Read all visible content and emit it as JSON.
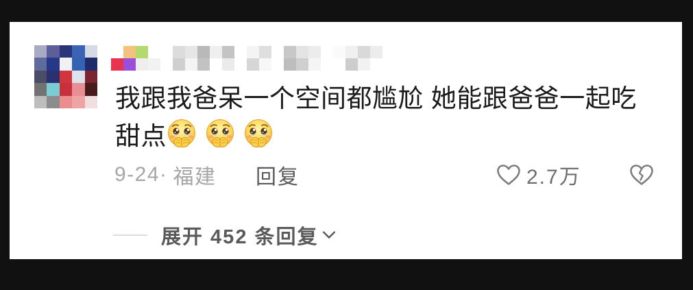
{
  "comment": {
    "text_lines": [
      "我跟我爸呆一个空间都尴尬 她能跟爸爸一起吃",
      "甜点"
    ],
    "emojis": [
      "shy-face-covering-mouth-icon",
      "shy-face-covering-mouth-icon",
      "shy-face-covering-mouth-icon"
    ],
    "date": "9-24",
    "separator": "·",
    "location": "福建",
    "reply_label": "回复",
    "like_icon": "heart-outline-icon",
    "like_count": "2.7万",
    "dislike_icon": "broken-heart-icon"
  },
  "replies": {
    "expand_label": "展开 452 条回复",
    "expand_icon": "chevron-down-icon"
  },
  "colors": {
    "page_background": "#111111",
    "card": "#ffffff",
    "comment_text": "#1a1a1a",
    "meta_text": "#a6a6a6",
    "action_text": "#5a5a5a",
    "count_text": "#6e6e6e",
    "icon_stroke": "#7d7d7d",
    "divider": "#dcdcdc"
  }
}
